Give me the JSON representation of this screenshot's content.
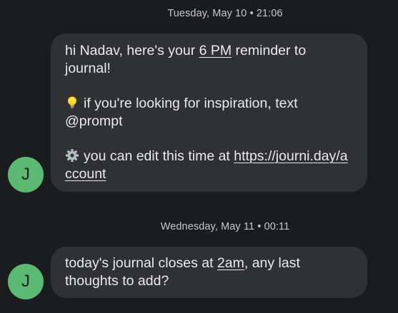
{
  "conversation": {
    "messages": [
      {
        "timestamp": "Tuesday, May 10 • 21:06",
        "avatar_initial": "J",
        "paragraphs": [
          {
            "parts": [
              "hi Nadav, here's your ",
              "6 PM",
              " reminder to journal!"
            ]
          },
          {
            "icon": "lightbulb-icon",
            "text": "if you're looking for inspiration, text @prompt"
          },
          {
            "icon": "gear-icon",
            "text": "you can edit this time at ",
            "link": "https://journi.day/account"
          }
        ]
      },
      {
        "timestamp": "Wednesday, May 11 • 00:11",
        "avatar_initial": "J",
        "parts": [
          "today's journal closes at ",
          "2am",
          ", any last thoughts to add?"
        ]
      }
    ]
  },
  "colors": {
    "background": "#1b1c1e",
    "bubble": "#303134",
    "avatar": "#5bb974",
    "text": "#e9eaee",
    "timestamp": "#c6c8ce"
  }
}
